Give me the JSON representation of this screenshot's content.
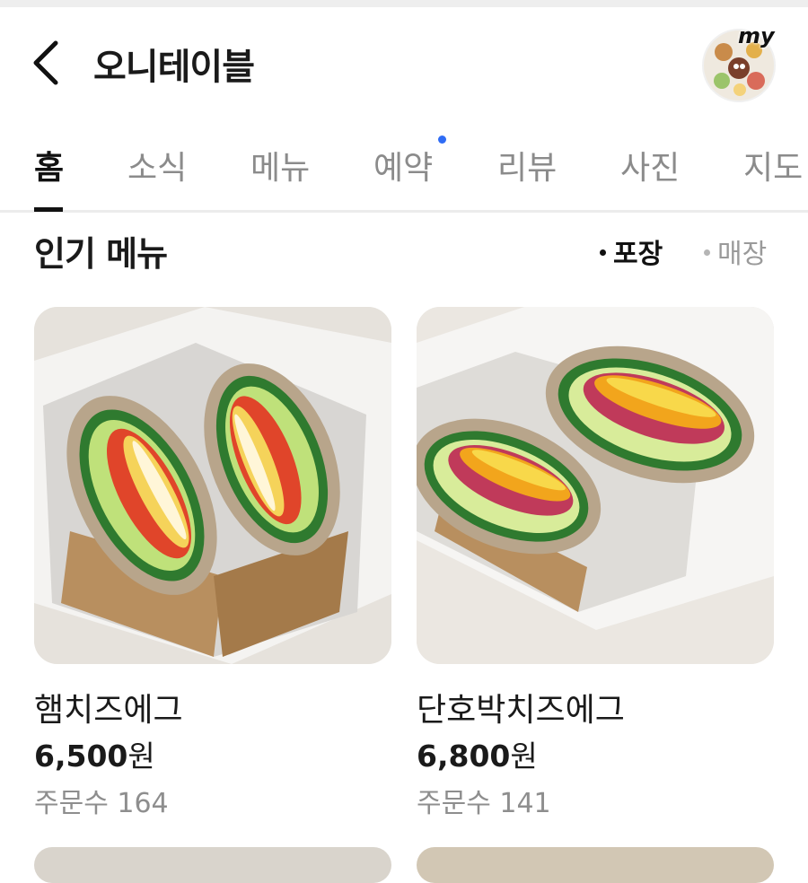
{
  "header": {
    "title": "오니테이블",
    "avatar_badge": "my"
  },
  "tabs": [
    {
      "label": "홈",
      "active": true
    },
    {
      "label": "소식",
      "active": false
    },
    {
      "label": "메뉴",
      "active": false
    },
    {
      "label": "예약",
      "active": false,
      "has_dot": true
    },
    {
      "label": "리뷰",
      "active": false
    },
    {
      "label": "사진",
      "active": false
    },
    {
      "label": "지도",
      "active": false
    }
  ],
  "section": {
    "title": "인기 메뉴",
    "filters": [
      {
        "label": "포장",
        "selected": true
      },
      {
        "label": "매장",
        "selected": false
      }
    ]
  },
  "menu_items": [
    {
      "name": "햄치즈에그",
      "price_number": "6,500",
      "price_unit": "원",
      "orders_label": "주문수",
      "orders_count": "164"
    },
    {
      "name": "단호박치즈에그",
      "price_number": "6,800",
      "price_unit": "원",
      "orders_label": "주문수",
      "orders_count": "141"
    }
  ],
  "colors": {
    "accent_dot": "#2f6cf5",
    "text_primary": "#1a1a1a",
    "text_muted": "#8e8e8e"
  }
}
